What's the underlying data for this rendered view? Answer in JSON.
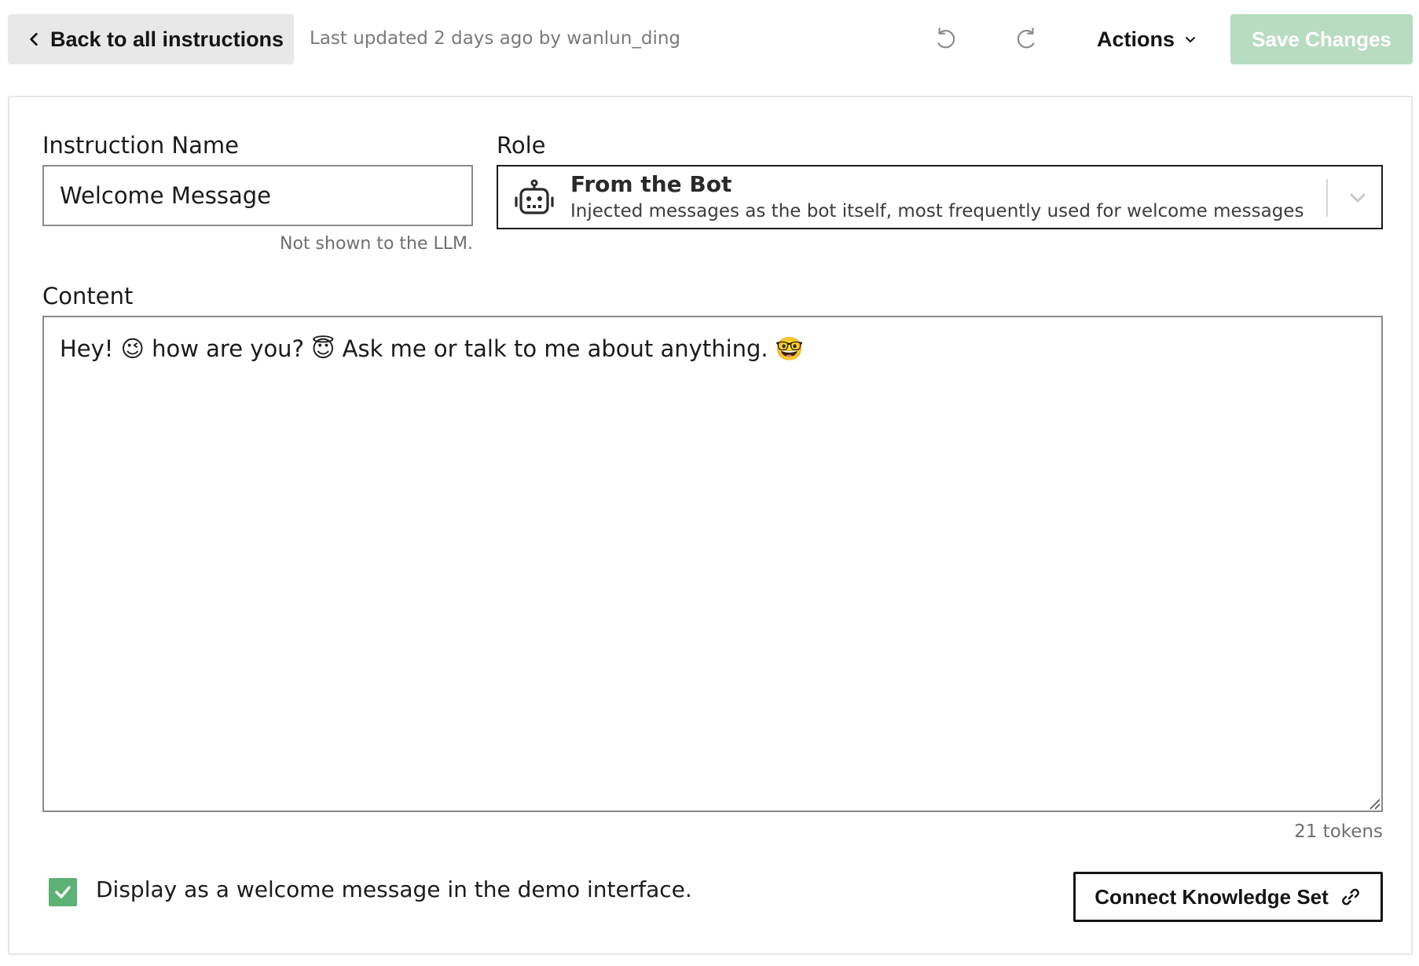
{
  "toolbar": {
    "back_label": "Back to all instructions",
    "last_updated": "Last updated 2 days ago by wanlun_ding",
    "actions_label": "Actions",
    "save_label": "Save Changes"
  },
  "form": {
    "name_label": "Instruction Name",
    "name_value": "Welcome Message",
    "name_hint": "Not shown to the LLM.",
    "role_label": "Role",
    "role_title": "From the Bot",
    "role_description": "Injected messages as the bot itself, most frequently used for welcome messages us",
    "content_label": "Content",
    "content_value": "Hey! 😉 how are you? 😇 Ask me or talk to me about anything. 🤓",
    "tokens": "21 tokens",
    "welcome_checkbox_label": "Display as a welcome message in the demo interface.",
    "welcome_checked": true,
    "connect_label": "Connect Knowledge Set"
  },
  "colors": {
    "save_disabled": "#b8dcc0",
    "checkbox_green": "#5bb274"
  },
  "icons": {
    "back": "chevron-left-icon",
    "undo": "undo-icon",
    "redo": "redo-icon",
    "actions": "chevron-down-icon",
    "role": "robot-icon",
    "connect": "link-icon"
  }
}
